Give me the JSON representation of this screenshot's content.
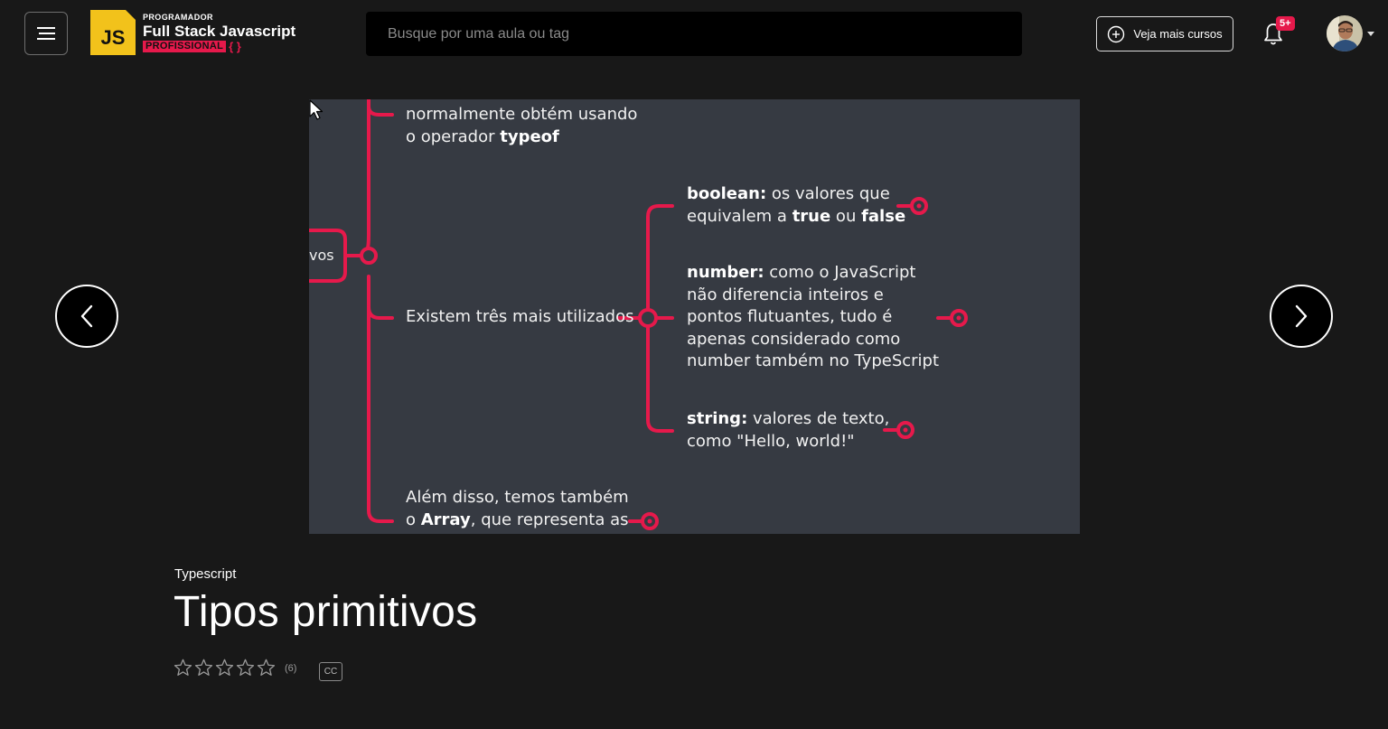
{
  "header": {
    "menu_icon": "hamburger-icon",
    "logo": {
      "badge_text": "JS",
      "line1": "PROGRAMADOR",
      "line2": "Full Stack Javascript",
      "line3": "PROFISSIONAL",
      "brace": "{ }"
    },
    "search": {
      "placeholder": "Busque por uma aula ou tag",
      "value": ""
    },
    "more_courses_label": "Veja mais cursos",
    "notification_badge": "5+"
  },
  "slide": {
    "texts": {
      "top_line1": "normalmente obtém usando",
      "top_line2_prefix": "o operador ",
      "top_line2_bold": "typeof",
      "root_label": "vos",
      "middle": "Existem três mais utilizados",
      "boolean_bold": "boolean:",
      "boolean_rest": " os valores que",
      "boolean_line2_prefix": "equivalem a ",
      "boolean_true": "true",
      "boolean_or": " ou ",
      "boolean_false": "false",
      "number_bold": "number:",
      "number_rest": " como o JavaScript",
      "number_line2": "não diferencia inteiros e",
      "number_line3": "pontos flutuantes, tudo é",
      "number_line4": "apenas considerado como",
      "number_line5": "number também no TypeScript",
      "string_bold": "string:",
      "string_rest": " valores de texto,",
      "string_line2": "como \"Hello, world!\"",
      "bottom_line1": "Além disso, temos também",
      "bottom_line2_prefix": "o ",
      "bottom_line2_bold": "Array",
      "bottom_line2_rest": ", que representa as"
    },
    "colors": {
      "background": "#363a42",
      "accent": "#e6194b"
    }
  },
  "lesson": {
    "course": "Typescript",
    "title": "Tipos primitivos",
    "rating_count": "(6)",
    "rating_value": 0,
    "rating_max": 5,
    "cc_label": "CC"
  }
}
